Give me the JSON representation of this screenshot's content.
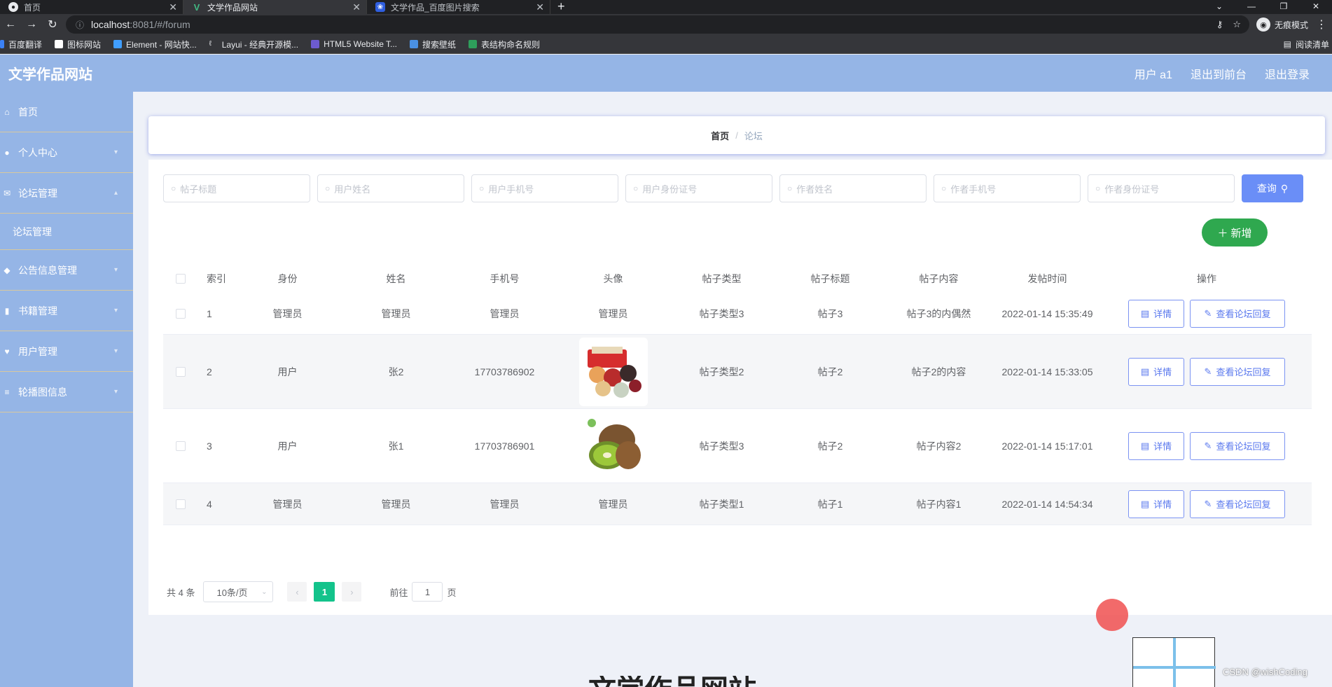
{
  "browser": {
    "tabs": [
      {
        "label": "首页",
        "active": false
      },
      {
        "label": "文学作品网站",
        "active": true
      },
      {
        "label": "文学作品_百度图片搜索",
        "active": false
      }
    ],
    "new_tab": "+",
    "url_host": "localhost",
    "url_path": ":8081/#/forum",
    "profile_label": "无痕模式",
    "bookmarks": [
      {
        "label": "百度翻译",
        "color": "#3b82f6"
      },
      {
        "label": "图标网站",
        "color": "#ffffff"
      },
      {
        "label": "Element - 网站快...",
        "color": "#409eff"
      },
      {
        "label": "Layui - 经典开源模...",
        "color": "#e8eaed"
      },
      {
        "label": "HTML5 Website T...",
        "color": "#6d5bd0"
      },
      {
        "label": "搜索壁纸",
        "color": "#4a90e2"
      },
      {
        "label": "表结构命名规则",
        "color": "#2e9e5b"
      }
    ],
    "reading_list": "阅读清单"
  },
  "header": {
    "title": "文学作品网站",
    "user": "用户 a1",
    "back_front": "退出到前台",
    "logout": "退出登录"
  },
  "sidebar": {
    "items": [
      {
        "label": "首页",
        "icon": "home-icon",
        "has_arrow": false
      },
      {
        "label": "个人中心",
        "icon": "user-icon",
        "has_arrow": true
      },
      {
        "label": "论坛管理",
        "icon": "forum-icon",
        "has_arrow": true
      },
      {
        "label": "论坛管理",
        "icon": "",
        "has_arrow": false,
        "sub": true
      },
      {
        "label": "公告信息管理",
        "icon": "notice-icon",
        "has_arrow": true
      },
      {
        "label": "书籍管理",
        "icon": "book-icon",
        "has_arrow": true
      },
      {
        "label": "用户管理",
        "icon": "users-icon",
        "has_arrow": true
      },
      {
        "label": "轮播图信息",
        "icon": "carousel-icon",
        "has_arrow": true
      }
    ]
  },
  "breadcrumb": {
    "home": "首页",
    "separator": "/",
    "current": "论坛"
  },
  "search": {
    "placeholders": [
      "帖子标题",
      "用户姓名",
      "用户手机号",
      "用户身份证号",
      "作者姓名",
      "作者手机号",
      "作者身份证号"
    ],
    "query_label": "查询"
  },
  "add_label": "新增",
  "table": {
    "headers": [
      "索引",
      "身份",
      "姓名",
      "手机号",
      "头像",
      "帖子类型",
      "帖子标题",
      "帖子内容",
      "发帖时间",
      "操作"
    ],
    "rows": [
      {
        "index": "1",
        "role": "管理员",
        "name": "管理员",
        "phone": "管理员",
        "avatar_text": "管理员",
        "avatar_image": "",
        "type": "帖子类型3",
        "title": "帖子3",
        "content": "帖子3的内偶然",
        "time": "2022-01-14 15:35:49"
      },
      {
        "index": "2",
        "role": "用户",
        "name": "张2",
        "phone": "17703786902",
        "avatar_text": "",
        "avatar_image": "snacks-image",
        "type": "帖子类型2",
        "title": "帖子2",
        "content": "帖子2的内容",
        "time": "2022-01-14 15:33:05"
      },
      {
        "index": "3",
        "role": "用户",
        "name": "张1",
        "phone": "17703786901",
        "avatar_text": "",
        "avatar_image": "kiwi-image",
        "type": "帖子类型3",
        "title": "帖子2",
        "content": "帖子内容2",
        "time": "2022-01-14 15:17:01"
      },
      {
        "index": "4",
        "role": "管理员",
        "name": "管理员",
        "phone": "管理员",
        "avatar_text": "管理员",
        "avatar_image": "",
        "type": "帖子类型1",
        "title": "帖子1",
        "content": "帖子内容1",
        "time": "2022-01-14 14:54:34"
      }
    ],
    "detail_label": "详情",
    "reply_label": "查看论坛回复"
  },
  "pagination": {
    "total": "共 4 条",
    "page_size": "10条/页",
    "current_page": "1",
    "goto_prefix": "前往",
    "goto_value": "1",
    "goto_suffix": "页"
  },
  "bottom_title": "文学作品网站",
  "watermark": "CSDN @wishCoding",
  "colors": {
    "accent": "#95b5e6",
    "primary": "#6a8ef7",
    "success": "#2fa84f",
    "page_active": "#13c38b"
  }
}
